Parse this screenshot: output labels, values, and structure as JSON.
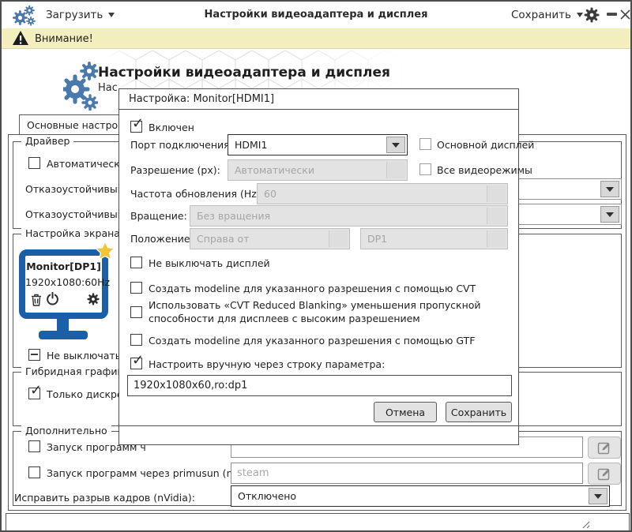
{
  "titlebar": {
    "load_label": "Загрузить",
    "title": "Настройки видеоадаптера и дисплея",
    "save_label": "Сохранить"
  },
  "warning": {
    "text": "Внимание!"
  },
  "header": {
    "title": "Настройки видеоадаптера и дисплея",
    "subtitle_fragment": "Нас"
  },
  "tabs": {
    "main_tab": "Основные настройки"
  },
  "driver_group": {
    "legend": "Драйвер",
    "auto_checkbox_fragment": "Автоматический в",
    "failsafe_label_1": "Отказоустойчивый др",
    "failsafe_label_2": "Отказоустойчивый др"
  },
  "screen_group": {
    "legend": "Настройка экрана",
    "monitor": {
      "name": "Monitor[DP1]",
      "mode": "1920x1080:60Hz"
    },
    "keep_on_fragment": "Не выключать ди"
  },
  "hybrid_group": {
    "legend": "Гибридная графика",
    "discrete_fragment": "Только дискретно"
  },
  "extra_group": {
    "legend": "Дополнительно",
    "run_fragment": "Запуск программ ч",
    "run_primus_label": "Запуск программ через primusun (nVidia):",
    "run_primus_placeholder": "steam",
    "tear_label": "Исправить разрыв кадров (nVidia):",
    "tear_value": "Отключено"
  },
  "dialog": {
    "title": "Настройка: Monitor[HDMI1]",
    "enabled_label": "Включен",
    "port_label": "Порт подключения:",
    "port_value": "HDMI1",
    "primary_label": "Основной дисплей",
    "resolution_label": "Разрешение (px):",
    "resolution_value": "Автоматически",
    "allmodes_label": "Все видеорежимы",
    "refresh_label": "Частота обновления (Hz):",
    "refresh_value": "60",
    "rotation_label": "Вращение:",
    "rotation_value": "Без вращения",
    "position_label": "Положение:",
    "position_value": "Справа от",
    "position_target": "DP1",
    "keep_on_label": "Не выключать дисплей",
    "cvt_label": "Создать modeline для указанного разрешения с помощью CVT",
    "cvt_rb_label": "Использовать «CVT Reduced Blanking» уменьшения пропускной способности для дисплеев с высоким разрешением",
    "gtf_label": "Создать modeline для указанного разрешения с помощью GTF",
    "manual_label": "Настроить вручную через строку параметра:",
    "param_value": "1920x1080x60,ro:dp1",
    "cancel_label": "Отмена",
    "save_label": "Сохранить"
  },
  "colors": {
    "accent_blue": "#4a7aab",
    "monitor_blue": "#1b5fa8",
    "star_yellow": "#f2c335",
    "warning_bg": "#f2eebe",
    "disabled_bg": "#e3e3e3",
    "disabled_text": "#a5a5a5"
  }
}
